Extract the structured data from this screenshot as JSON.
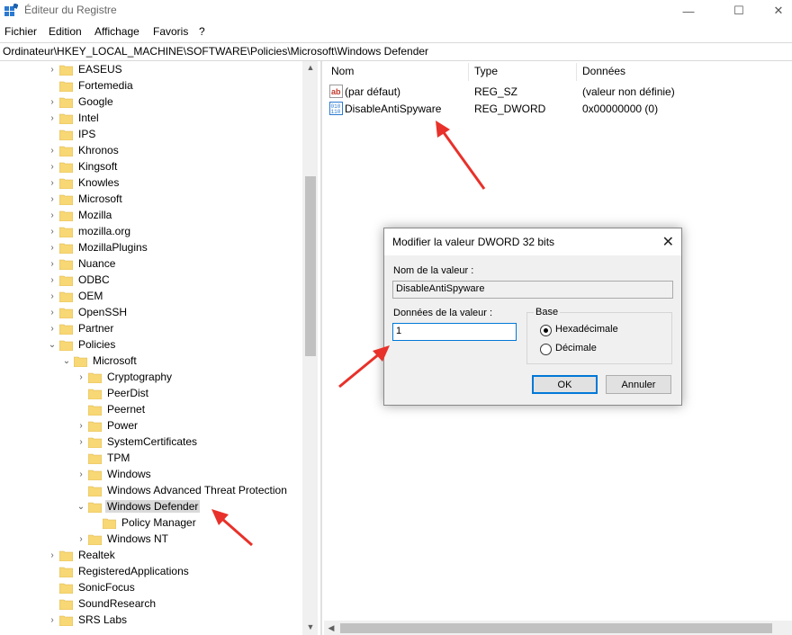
{
  "window": {
    "title": "Éditeur du Registre",
    "minimize": "—",
    "maximize": "☐",
    "close": "✕"
  },
  "menu": [
    "Fichier",
    "Edition",
    "Affichage",
    "Favoris",
    "?"
  ],
  "address": "Ordinateur\\HKEY_LOCAL_MACHINE\\SOFTWARE\\Policies\\Microsoft\\Windows Defender",
  "tree": [
    "EASEUS",
    "Fortemedia",
    "Google",
    "Intel",
    "IPS",
    "Khronos",
    "Kingsoft",
    "Knowles",
    "Microsoft",
    "Mozilla",
    "mozilla.org",
    "MozillaPlugins",
    "Nuance",
    "ODBC",
    "OEM",
    "OpenSSH",
    "Partner",
    "Policies",
    "Microsoft",
    "Cryptography",
    "PeerDist",
    "Peernet",
    "Power",
    "SystemCertificates",
    "TPM",
    "Windows",
    "Windows Advanced Threat Protection",
    "Windows Defender",
    "Policy Manager",
    "Windows NT",
    "Realtek",
    "RegisteredApplications",
    "SonicFocus",
    "SoundResearch",
    "SRS Labs"
  ],
  "list": {
    "columns": [
      "Nom",
      "Type",
      "Données"
    ],
    "rows": [
      {
        "name": "(par défaut)",
        "type": "REG_SZ",
        "data": "(valeur non définie)",
        "icon": "string-value-icon"
      },
      {
        "name": "DisableAntiSpyware",
        "type": "REG_DWORD",
        "data": "0x00000000 (0)",
        "icon": "binary-value-icon"
      }
    ]
  },
  "dialog": {
    "title": "Modifier la valeur DWORD 32 bits",
    "value_name_label": "Nom de la valeur :",
    "value_name": "DisableAntiSpyware",
    "value_data_label": "Données de la valeur :",
    "value_data": "1",
    "base_label": "Base",
    "hex_label": "Hexadécimale",
    "dec_label": "Décimale",
    "ok": "OK",
    "cancel": "Annuler",
    "close": "✕"
  },
  "colors": {
    "selection": "#d9d9d9",
    "focus": "#0078d7",
    "annotation_arrow": "#e8312a",
    "folder": "#f8d775"
  }
}
